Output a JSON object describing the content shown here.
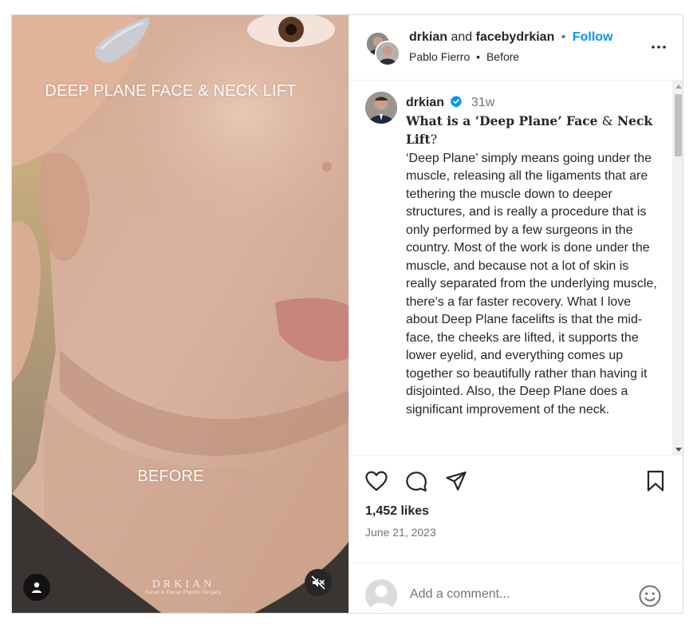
{
  "media": {
    "overlay_title": "DEEP PLANE FACE & NECK LIFT",
    "overlay_label": "BEFORE",
    "brand_name": "DRKIAN",
    "brand_tagline": "Nasal & Facial Plastic Surgery",
    "user_tag_icon": "person-icon",
    "mute_icon": "speaker-muted-icon"
  },
  "header": {
    "user_primary": "drkian",
    "and_text": "and",
    "user_collab": "facebydrkian",
    "follow_label": "Follow",
    "sub_user": "Pablo Fierro",
    "sub_audio": "Before",
    "more_icon": "more-horizontal-icon"
  },
  "caption": {
    "username": "drkian",
    "verified": true,
    "time_ago": "31w",
    "heading_part1": "What is a ‘Deep Plane’ Face",
    "heading_amp": " & ",
    "heading_part2": "Neck Lift",
    "heading_q": "?",
    "body": "‘Deep Plane’ simply means going under the muscle, releasing all the ligaments that are tethering the muscle down to deeper structures, and is really a procedure that is only performed by a few surgeons in the country. Most of the work is done under the muscle, and because not a lot of skin is really separated from the underlying muscle, there’s a far faster recovery. What I love about Deep Plane facelifts is that the mid-face, the cheeks are lifted, it supports the lower eyelid, and everything comes up together so beautifully rather than having it disjointed. Also, the Deep Plane does a significant improvement of the neck."
  },
  "actions": {
    "like_icon": "heart-icon",
    "comment_icon": "comment-bubble-icon",
    "share_icon": "paper-plane-icon",
    "save_icon": "bookmark-icon"
  },
  "stats": {
    "likes": "1,452 likes",
    "date": "June 21, 2023"
  },
  "comment_box": {
    "placeholder": "Add a comment...",
    "emoji_icon": "smiley-icon"
  },
  "colors": {
    "follow_blue": "#0095f6",
    "verified_blue": "#0095f6",
    "muted_gray": "#737373",
    "border": "#dbdbdb"
  }
}
